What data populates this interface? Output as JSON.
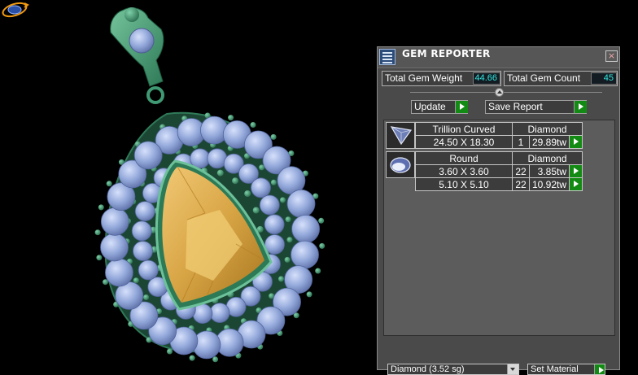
{
  "panel": {
    "title": "GEM REPORTER",
    "close_glyph": "×",
    "total_weight_label": "Total Gem Weight",
    "total_weight_value": "44.66",
    "total_count_label": "Total Gem Count",
    "total_count_value": "45",
    "update_label": "Update",
    "save_report_label": "Save Report",
    "gems": [
      {
        "shape": "Trillion Curved",
        "material": "Diamond",
        "rows": [
          {
            "size": "24.50 X 18.30",
            "count": "1",
            "weight": "29.89tw"
          }
        ]
      },
      {
        "shape": "Round",
        "material": "Diamond",
        "rows": [
          {
            "size": "3.60 X 3.60",
            "count": "22",
            "weight": "3.85tw"
          },
          {
            "size": "5.10 X 5.10",
            "count": "22",
            "weight": "10.92tw"
          }
        ]
      }
    ],
    "material_select_value": "Diamond     (3.52 sg)",
    "set_material_label": "Set Material"
  },
  "icons": {
    "app": "gem-reporter-icon",
    "close": "close-icon",
    "gizmo": "orbit-gizmo-icon",
    "trillion": "trillion-gem-icon",
    "round": "round-gem-icon"
  },
  "colors": {
    "metal": "#3f9a73",
    "gem_blue": "#8fa4d6",
    "center_stone": "#d7a640",
    "value_text": "#33e8e0",
    "go_button": "#138a13"
  }
}
